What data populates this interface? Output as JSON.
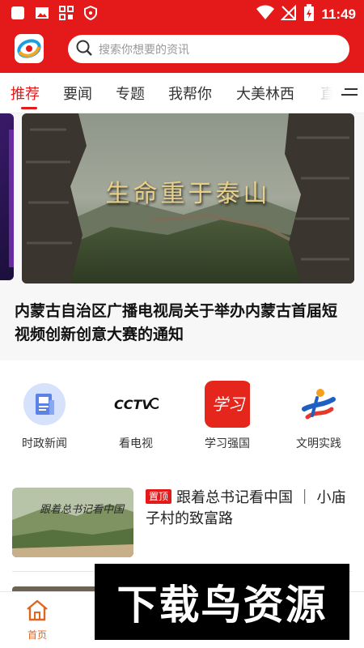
{
  "status_bar": {
    "time": "11:49",
    "left_icons": [
      "app-icon",
      "image-icon",
      "grid-icon",
      "shield-icon"
    ],
    "right_icons": [
      "wifi-icon",
      "no-signal-icon",
      "battery-icon"
    ]
  },
  "header": {
    "logo": "app-logo",
    "search_placeholder": "搜索你想要的资讯"
  },
  "tabs": {
    "items": [
      "推荐",
      "要闻",
      "专题",
      "我帮你",
      "大美林西",
      "直"
    ],
    "active": "推荐"
  },
  "banner": {
    "image_caption": "生命重于泰山",
    "title": "内蒙古自治区广播电视局关于举办内蒙古首届短视频创新创意大赛的通知"
  },
  "quick_links": [
    {
      "label": "时政新闻",
      "icon": "newspaper-icon"
    },
    {
      "label": "看电视",
      "icon": "cctv-logo-icon"
    },
    {
      "label": "学习强国",
      "icon": "xuexi-logo-icon"
    },
    {
      "label": "文明实践",
      "icon": "civilization-logo-icon"
    }
  ],
  "news": [
    {
      "badge": "置顶",
      "title": "跟着总书记看中国 ｜ 小庙子村的致富路",
      "thumb_text": "跟着总书记看中国"
    }
  ],
  "bottom_nav": {
    "items": [
      {
        "label": "首页",
        "icon": "home-icon",
        "active": true
      }
    ]
  },
  "watermark": {
    "text": "下载鸟资源"
  },
  "colors": {
    "brand_red": "#e41a1a",
    "nav_active": "#e0661f"
  }
}
